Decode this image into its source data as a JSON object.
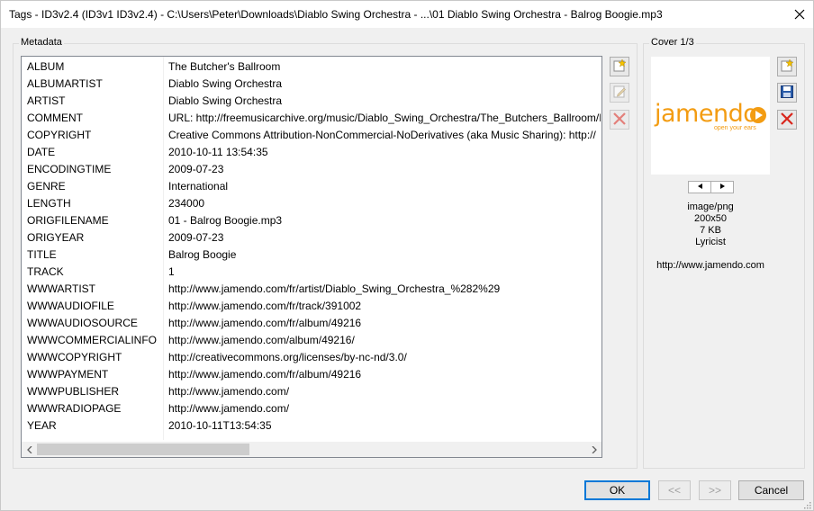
{
  "window": {
    "title": "Tags - ID3v2.4 (ID3v1 ID3v2.4) - C:\\Users\\Peter\\Downloads\\Diablo Swing Orchestra - ...\\01 Diablo Swing Orchestra - Balrog Boogie.mp3",
    "close_icon": "close-icon"
  },
  "metadata": {
    "label": "Metadata",
    "rows": [
      {
        "key": "ALBUM",
        "value": "The Butcher's Ballroom"
      },
      {
        "key": "ALBUMARTIST",
        "value": "Diablo Swing Orchestra"
      },
      {
        "key": "ARTIST",
        "value": "Diablo Swing Orchestra"
      },
      {
        "key": "COMMENT",
        "value": "URL: http://freemusicarchive.org/music/Diablo_Swing_Orchestra/The_Butchers_Ballroom/Bal"
      },
      {
        "key": "COPYRIGHT",
        "value": "Creative Commons Attribution-NonCommercial-NoDerivatives (aka Music Sharing): http://"
      },
      {
        "key": "DATE",
        "value": "2010-10-11 13:54:35"
      },
      {
        "key": "ENCODINGTIME",
        "value": "2009-07-23"
      },
      {
        "key": "GENRE",
        "value": "International"
      },
      {
        "key": "LENGTH",
        "value": "234000"
      },
      {
        "key": "ORIGFILENAME",
        "value": "01 - Balrog Boogie.mp3"
      },
      {
        "key": "ORIGYEAR",
        "value": "2009-07-23"
      },
      {
        "key": "TITLE",
        "value": "Balrog Boogie"
      },
      {
        "key": "TRACK",
        "value": "1"
      },
      {
        "key": "WWWARTIST",
        "value": "http://www.jamendo.com/fr/artist/Diablo_Swing_Orchestra_%282%29"
      },
      {
        "key": "WWWAUDIOFILE",
        "value": "http://www.jamendo.com/fr/track/391002"
      },
      {
        "key": "WWWAUDIOSOURCE",
        "value": "http://www.jamendo.com/fr/album/49216"
      },
      {
        "key": "WWWCOMMERCIALINFO",
        "value": "http://www.jamendo.com/album/49216/"
      },
      {
        "key": "WWWCOPYRIGHT",
        "value": "http://creativecommons.org/licenses/by-nc-nd/3.0/"
      },
      {
        "key": "WWWPAYMENT",
        "value": "http://www.jamendo.com/fr/album/49216"
      },
      {
        "key": "WWWPUBLISHER",
        "value": "http://www.jamendo.com/"
      },
      {
        "key": "WWWRADIOPAGE",
        "value": "http://www.jamendo.com/"
      },
      {
        "key": "YEAR",
        "value": "2010-10-11T13:54:35"
      }
    ],
    "tools": {
      "add_icon": "add-tag-icon",
      "edit_icon": "edit-tag-icon",
      "delete_icon": "delete-tag-icon"
    }
  },
  "cover": {
    "label": "Cover 1/3",
    "image_logo_text": "jamendo",
    "image_tagline": "open your ears",
    "prev_icon": "triangle-left-icon",
    "next_icon": "triangle-right-icon",
    "mime": "image/png",
    "dimensions": "200x50",
    "size": "7 KB",
    "type": "Lyricist",
    "description": "http://www.jamendo.com",
    "tools": {
      "add_icon": "add-cover-icon",
      "save_icon": "save-icon",
      "delete_icon": "delete-cover-icon"
    }
  },
  "buttons": {
    "ok": "OK",
    "prev": "<<",
    "next": ">>",
    "cancel": "Cancel"
  },
  "colors": {
    "accent": "#0078d7",
    "delete_red": "#d9261c",
    "jamendo_orange": "#f39c12"
  }
}
